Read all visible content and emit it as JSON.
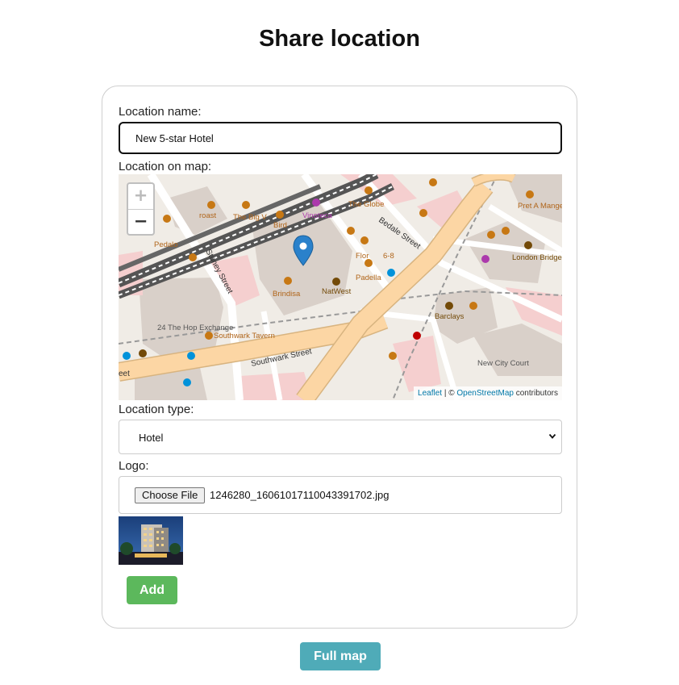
{
  "page": {
    "title": "Share location"
  },
  "form": {
    "location_name": {
      "label": "Location name:",
      "value": "New 5-star Hotel"
    },
    "map": {
      "label": "Location on map:",
      "zoom_in": "+",
      "zoom_out": "−",
      "attribution": {
        "leaflet": "Leaflet",
        "separator": "| ©",
        "osm": "OpenStreetMap",
        "suffix": "contributors"
      },
      "places": [
        "roast",
        "The Big V",
        "Bird",
        "Pedalo",
        "Vinoteca",
        "The Globe",
        "Pret A Manger",
        "Flor",
        "6-8",
        "London Bridge Post Office",
        "Padella",
        "Brindisa",
        "NatWest",
        "Barclays",
        "24 The Hop Exchange",
        "Southwark Tavern",
        "New City Court"
      ],
      "streets": [
        "Stoney Street",
        "Bedale Street",
        "Southwark Street",
        "eet"
      ],
      "marker": "map-marker"
    },
    "location_type": {
      "label": "Location type:",
      "selected": "Hotel"
    },
    "logo": {
      "label": "Logo:",
      "button_label": "Choose File",
      "file_name": "1246280_16061017110043391702.jpg"
    },
    "add_button": "Add"
  },
  "full_map_button": "Full map",
  "colors": {
    "add_button": "#5cb85c",
    "full_map_button": "#4fabb8",
    "map_marker": "#2a81cb",
    "major_road": "#fcd6a4",
    "railway": "#555555"
  }
}
